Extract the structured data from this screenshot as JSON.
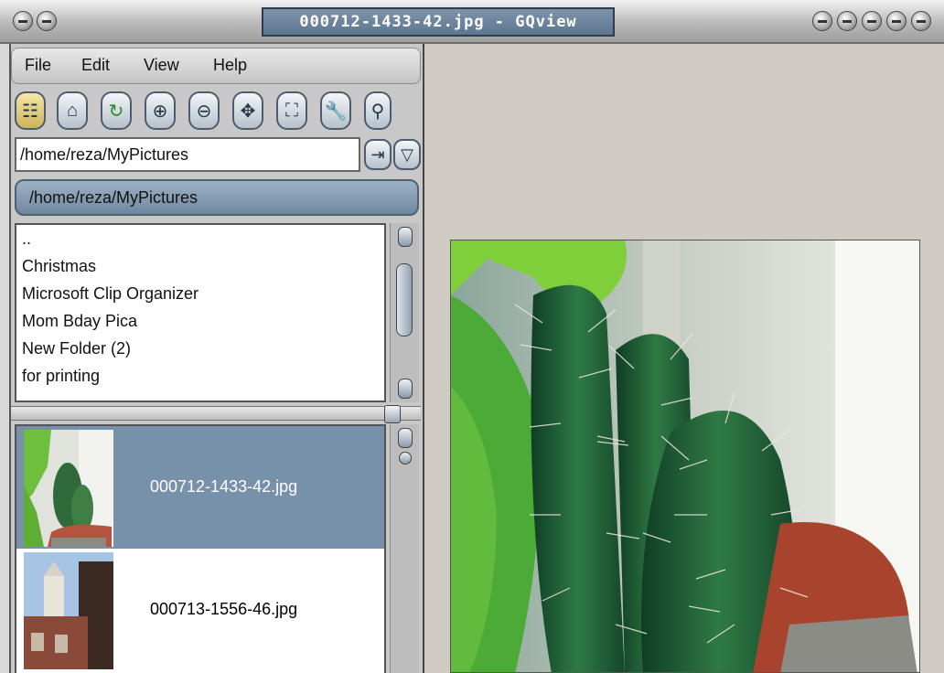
{
  "window": {
    "title": "000712-1433-42.jpg - GQview"
  },
  "menu": [
    "File",
    "Edit",
    "View",
    "Help"
  ],
  "toolbar": {
    "icons": [
      "thumbnails-icon",
      "home-icon",
      "refresh-icon",
      "zoom-in-icon",
      "zoom-out-icon",
      "zoom-fit-icon",
      "fullscreen-icon",
      "settings-icon",
      "float-icon"
    ]
  },
  "path": {
    "input_value": "/home/reza/MyPictures",
    "label": "/home/reza/MyPictures"
  },
  "directories": [
    "..",
    "Christmas",
    "Microsoft Clip Organizer",
    "Mom Bday Pica",
    "New Folder (2)",
    "for printing"
  ],
  "files": [
    {
      "name": "000712-1433-42.jpg",
      "selected": true
    },
    {
      "name": "000713-1556-46.jpg",
      "selected": false
    }
  ],
  "colors": {
    "selection": "#7891ab",
    "title_box": "#5d7690",
    "path_label": "#8aa0b6"
  }
}
